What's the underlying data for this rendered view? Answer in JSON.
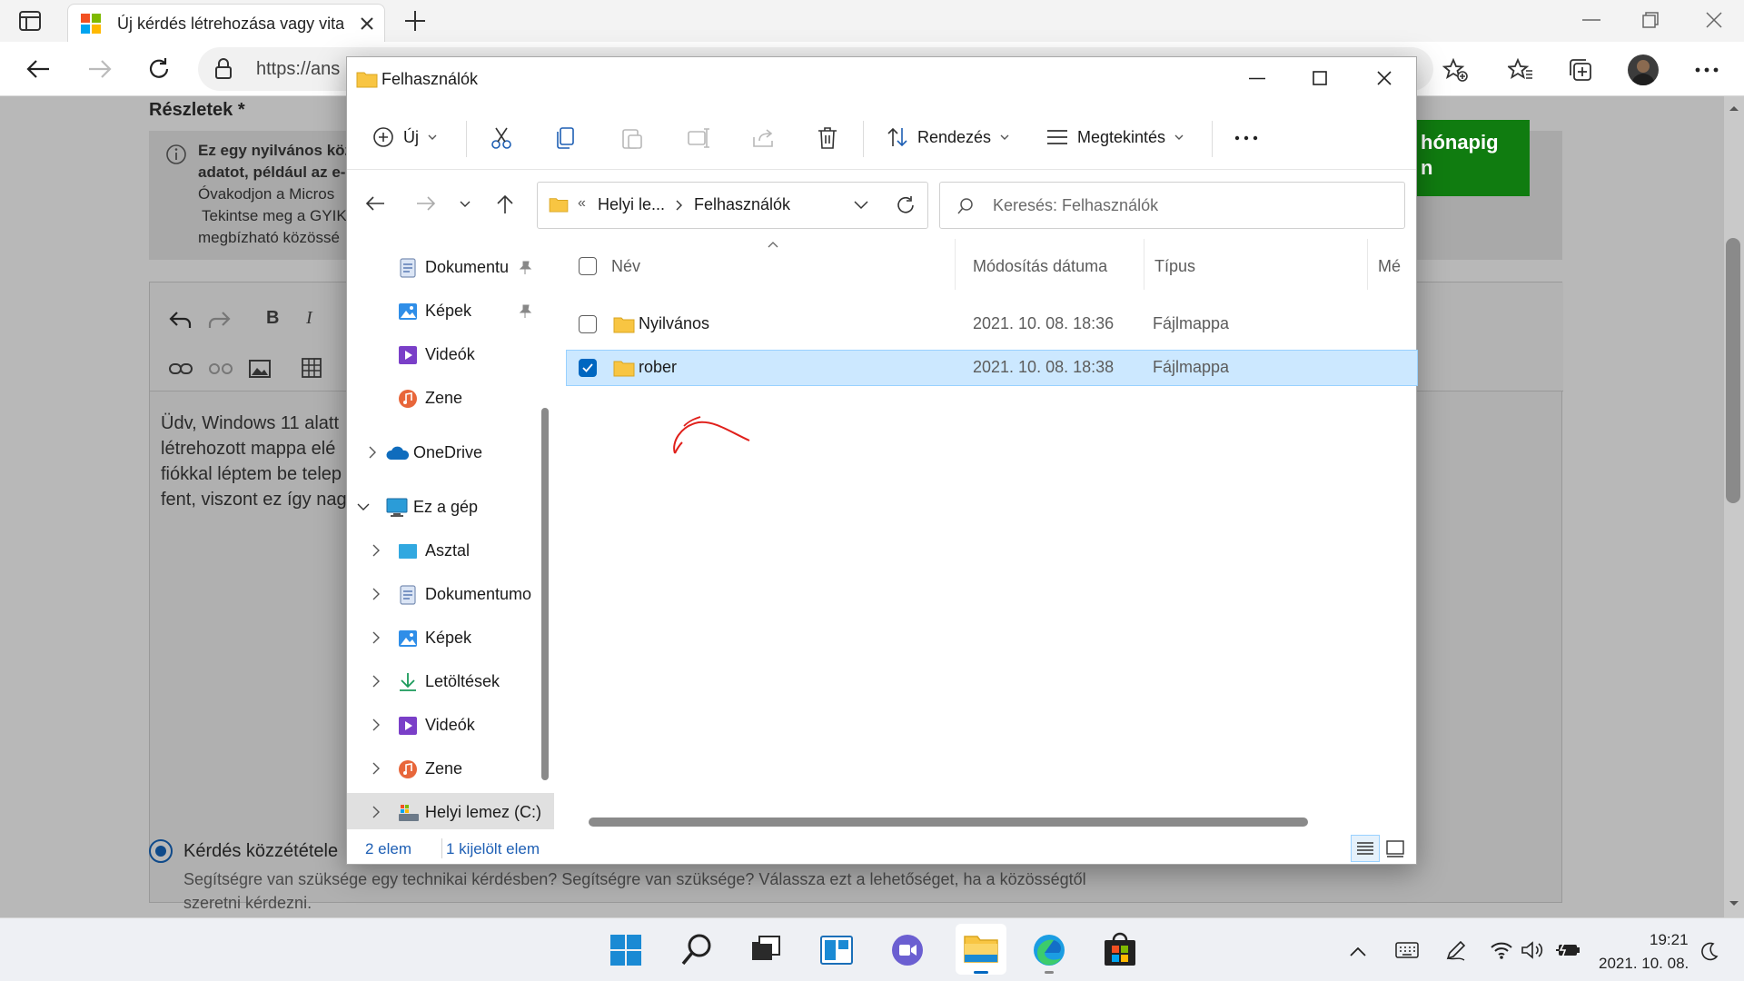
{
  "browser": {
    "tab_title": "Új kérdés létrehozása vagy vita in",
    "url": "https://ans"
  },
  "page": {
    "details_label": "Részletek *",
    "notice_line1": "Ez egy nyilvános köz",
    "notice_line2": "adatot, például az e-",
    "notice_line3": "Óvakodjon a Micros",
    "notice_line4": "Tekintse meg a GYIK",
    "notice_line5": "megbízható közössé",
    "green_button_line1": "hónapig",
    "green_button_line2": "n",
    "body_line1": "Üdv, Windows 11 alatt",
    "body_line2": "létrehozott mappa elé",
    "body_line3": "fiókkal léptem be telep",
    "body_line4": "fent, viszont ez így nag",
    "radio_label": "Kérdés közzététele",
    "radio_desc_line1": "Segítségre van szüksége egy technikai kérdésben? Segítségre van szüksége? Válassza ezt a lehetőséget, ha a közösségtől",
    "radio_desc_line2": "szeretni kérdezni."
  },
  "explorer": {
    "title": "Felhasználók",
    "commands": {
      "new": "Új",
      "sort": "Rendezés",
      "view": "Megtekintés",
      "more": "..."
    },
    "breadcrumb": {
      "sep": "«",
      "part1": "Helyi le...",
      "part2": "Felhasználók"
    },
    "search_placeholder": "Keresés: Felhasználók",
    "nav": [
      {
        "label": "Dokumentu"
      },
      {
        "label": "Képek"
      },
      {
        "label": "Videók"
      },
      {
        "label": "Zene"
      },
      {
        "label": "OneDrive"
      },
      {
        "label": "Ez a gép"
      },
      {
        "label": "Asztal"
      },
      {
        "label": "Dokumentumo"
      },
      {
        "label": "Képek"
      },
      {
        "label": "Letöltések"
      },
      {
        "label": "Videók"
      },
      {
        "label": "Zene"
      },
      {
        "label": "Helyi lemez (C:)"
      }
    ],
    "columns": {
      "name": "Név",
      "date": "Módosítás dátuma",
      "type": "Típus",
      "size": "Mé"
    },
    "rows": [
      {
        "name": "Nyilvános",
        "date": "2021. 10. 08. 18:36",
        "type": "Fájlmappa"
      },
      {
        "name": "rober",
        "date": "2021. 10. 08. 18:38",
        "type": "Fájlmappa"
      }
    ],
    "status": {
      "count": "2 elem",
      "selected": "1 kijelölt elem"
    }
  },
  "taskbar": {
    "time": "19:21",
    "date": "2021. 10. 08."
  },
  "colors": {
    "accent": "#0067c0",
    "selection": "#cce8ff",
    "green_button": "#107c10",
    "folder": "#f8c542",
    "annotation": "#e0201b"
  }
}
